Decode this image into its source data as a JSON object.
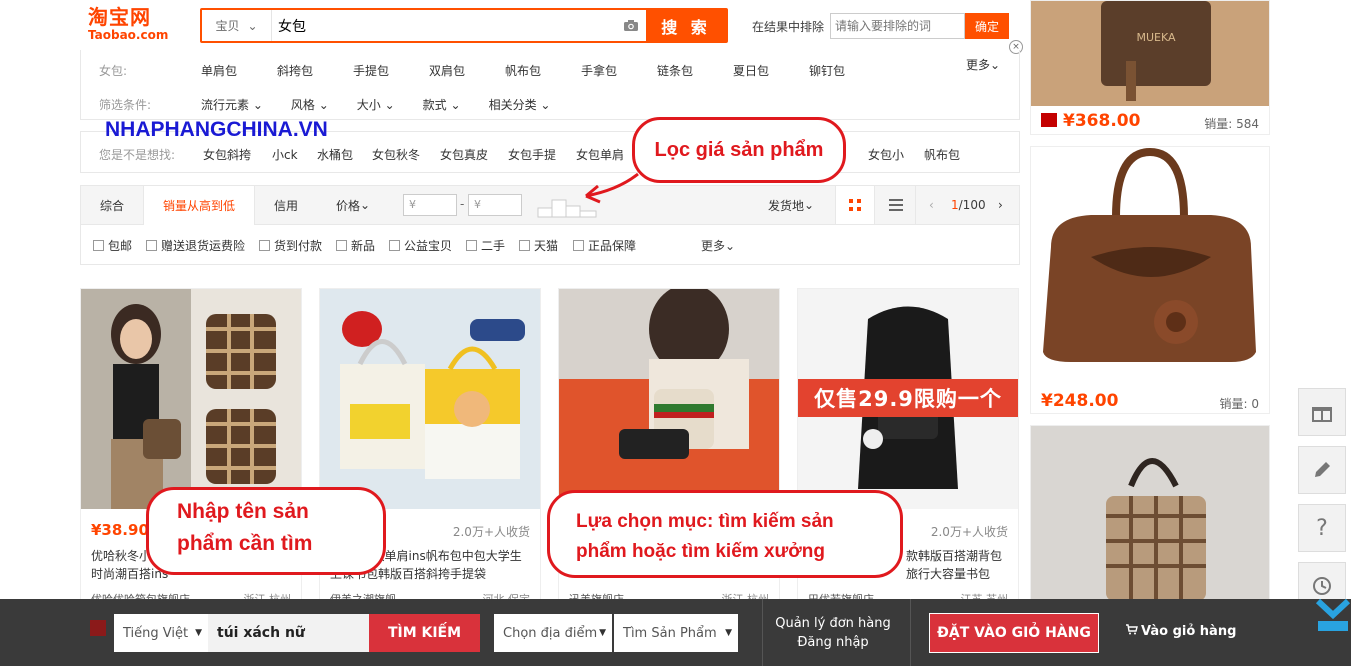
{
  "header": {
    "logo_cn": "淘宝网",
    "logo_en": "Taobao.com",
    "search_category": "宝贝",
    "search_query": "女包",
    "search_button": "搜 索",
    "exclude_label": "在结果中排除",
    "exclude_placeholder": "请输入要排除的词",
    "exclude_button": "确定",
    "close": "×"
  },
  "filters": {
    "bag_label": "女包:",
    "bag_items": [
      "单肩包",
      "斜挎包",
      "手提包",
      "双肩包",
      "帆布包",
      "手拿包",
      "链条包",
      "夏日包",
      "铆钉包"
    ],
    "more": "更多",
    "cond_label": "筛选条件:",
    "cond_items": [
      "流行元素",
      "风格",
      "大小",
      "款式",
      "相关分类"
    ]
  },
  "suggest": {
    "label": "您是不是想找:",
    "items": [
      "女包斜挎",
      "小ck",
      "水桶包",
      "女包秋冬",
      "女包真皮",
      "女包手提",
      "女包单肩",
      "女包小",
      "帆布包"
    ]
  },
  "watermark": "NHAPHANGCHINA.VN",
  "sort": {
    "tabs": [
      "综合",
      "销量从高到低",
      "信用",
      "价格"
    ],
    "price_from": "¥",
    "price_to": "¥",
    "ship_from": "发货地",
    "page": "1/100",
    "page_current": "1",
    "page_total": "/100"
  },
  "options": {
    "items": [
      "包邮",
      "赠送退货运费险",
      "货到付款",
      "新品",
      "公益宝贝",
      "二手",
      "天猫",
      "正品保障"
    ],
    "more": "更多"
  },
  "products": [
    {
      "price": "¥38.90",
      "sold": "",
      "title1": "优哈秋冬小",
      "title2": "时尚潮百搭ins",
      "shop": "优哈优哈箱包旗舰店",
      "loc": "浙江 杭州"
    },
    {
      "price": "",
      "sold": "2.0万+人收货",
      "title1": "2019新款单肩ins帆布包中包大学生",
      "title2": "上课书包韩版百搭斜挎手提袋",
      "shop": "伊美之潮旗舰",
      "loc": "河北 保定"
    },
    {
      "price": "",
      "sold": "",
      "title1": "",
      "title2": "",
      "shop": "迅美旗舰店",
      "loc": "浙江 杭州"
    },
    {
      "price": "",
      "sold": "2.0万+人收货",
      "title1": "款韩版百搭潮背包",
      "title2": "旅行大容量书包",
      "shop": "巴优若旗舰店",
      "loc": "江苏 苏州"
    }
  ],
  "product4_banner": "仅售29.9限购一个",
  "right_column": [
    {
      "price": "¥368.00",
      "sold_label": "销量:",
      "sold": "584",
      "brand": "MUEKA"
    },
    {
      "price": "¥248.00",
      "sold_label": "销量:",
      "sold": "0"
    }
  ],
  "annotations": {
    "price_filter": "Lọc giá sản phẩm",
    "enter_name_1": "Nhập tên sản",
    "enter_name_2": "phẩm cần tìm",
    "choose_1": "Lựa chọn mục:  tìm kiếm sản",
    "choose_2": "phẩm hoặc tìm kiếm xưởng"
  },
  "bottom_bar": {
    "language": "Tiếng Việt",
    "query": "túi xách nữ",
    "search_button": "TÌM KIẾM",
    "location": "Chọn địa điểm",
    "search_type": "Tìm Sản Phẩm",
    "manage_orders": "Quản lý đơn hàng",
    "login": "Đăng nhập",
    "add_to_cart": "ĐẶT VÀO GIỎ HÀNG",
    "go_to_cart": "Vào giỏ hàng"
  },
  "side_tools": [
    "gift-icon",
    "edit-icon",
    "help-icon",
    "history-icon"
  ],
  "colors": {
    "taobao_orange": "#ff5000",
    "annotation_red": "#e0191e",
    "bottom_bar": "#3a3a3a",
    "cart_red": "#d9323b"
  }
}
